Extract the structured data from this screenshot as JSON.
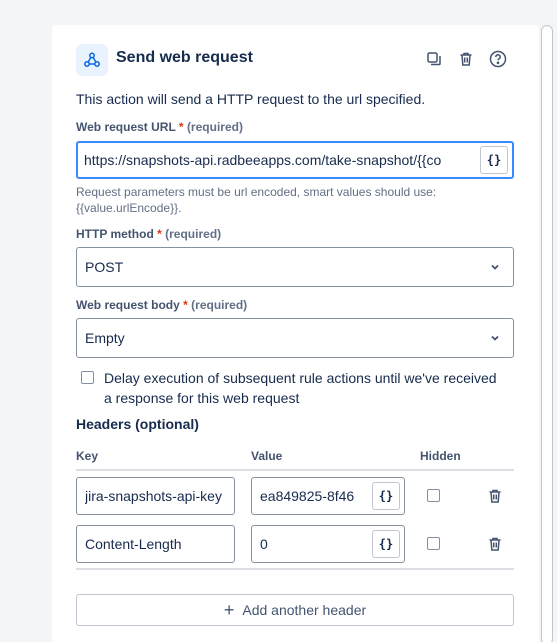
{
  "header": {
    "title": "Send web request",
    "icon": "webhook-icon"
  },
  "description": "This action will send a HTTP request to the url specified.",
  "url_field": {
    "label": "Web request URL",
    "required_mark": "*",
    "required_text": "(required)",
    "value": "https://snapshots-api.radbeeapps.com/take-snapshot/{{co",
    "smart_button": "{}",
    "help": "Request parameters must be url encoded, smart values should use: {{value.urlEncode}}."
  },
  "method_field": {
    "label": "HTTP method",
    "required_mark": "*",
    "required_text": "(required)",
    "value": "POST"
  },
  "body_field": {
    "label": "Web request body",
    "required_mark": "*",
    "required_text": "(required)",
    "value": "Empty"
  },
  "delay_checkbox": {
    "label": "Delay execution of subsequent rule actions until we've received a response for this web request",
    "checked": false
  },
  "headers": {
    "title": "Headers (optional)",
    "columns": {
      "key": "Key",
      "value": "Value",
      "hidden": "Hidden"
    },
    "rows": [
      {
        "key": "jira-snapshots-api-key",
        "value": "ea849825-8f46",
        "smart": "{}",
        "hidden": false
      },
      {
        "key": "Content-Length",
        "value": "0",
        "smart": "{}",
        "hidden": false
      }
    ],
    "add_label": "Add another header"
  },
  "colors": {
    "accent": "#388bff",
    "required": "#de350b",
    "text": "#172b4d",
    "subtle": "#626f86"
  }
}
